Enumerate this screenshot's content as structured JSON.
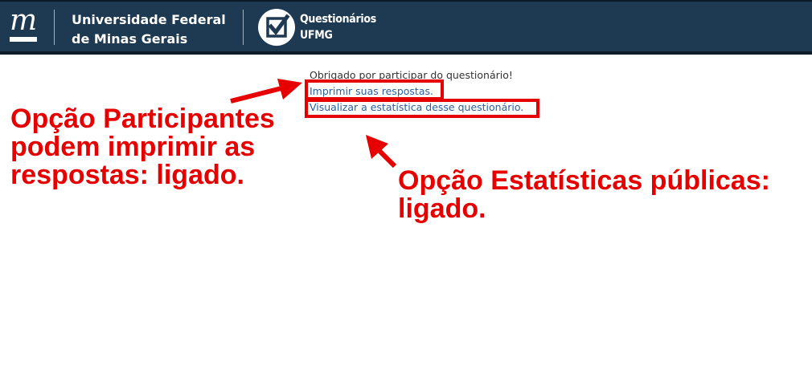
{
  "header": {
    "university_name_line1": "Universidade Federal",
    "university_name_line2": "de Minas Gerais",
    "app_name_line1": "Questionários",
    "app_name_line2": "UFMG",
    "background_color": "#1e3a52"
  },
  "content": {
    "thank_you": "Obrigado por participar do questionário!",
    "print_link": "Imprimir suas respostas.",
    "stats_link": "Visualizar a estatística desse questionário."
  },
  "annotations": {
    "participants_option": "Opção Participantes podem imprimir as respostas: ligado.",
    "participants_line1": "Opção Participantes",
    "participants_line2": "podem imprimir as",
    "participants_line3": "respostas: ligado.",
    "statistics_line1": "Opção Estatísticas públicas:",
    "statistics_line2": "ligado.",
    "color": "#e60000"
  }
}
